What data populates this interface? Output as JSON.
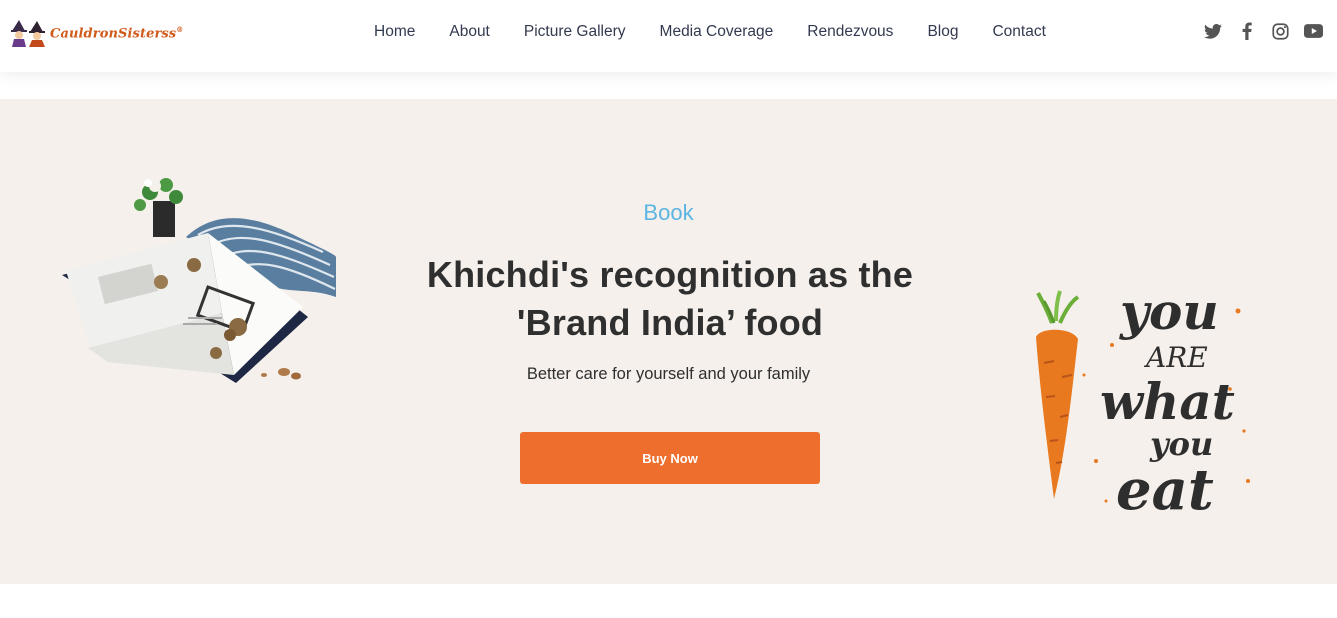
{
  "brand": {
    "name": "CauldronSisterss",
    "mark": "®"
  },
  "nav": [
    {
      "label": "Home"
    },
    {
      "label": "About"
    },
    {
      "label": "Picture Gallery"
    },
    {
      "label": "Media Coverage"
    },
    {
      "label": "Rendezvous"
    },
    {
      "label": "Blog"
    },
    {
      "label": "Contact"
    }
  ],
  "social": [
    {
      "icon": "twitter-icon"
    },
    {
      "icon": "facebook-icon"
    },
    {
      "icon": "instagram-icon"
    },
    {
      "icon": "youtube-icon"
    }
  ],
  "hero": {
    "kicker": "Book",
    "title_line1": "Khichdi's recognition as the",
    "title_line2": "'Brand India’ food",
    "subtitle": "Better care for yourself and your family",
    "cta": "Buy Now"
  },
  "slogan": {
    "line1": "you",
    "line2": "ARE",
    "line3": "what",
    "line4": "you",
    "line5": "eat"
  },
  "colors": {
    "accent": "#ee6e2e",
    "kicker": "#5db5e2",
    "hero_bg": "#f5f0eb",
    "nav_text": "#333a50",
    "logo": "#d05a1a"
  }
}
